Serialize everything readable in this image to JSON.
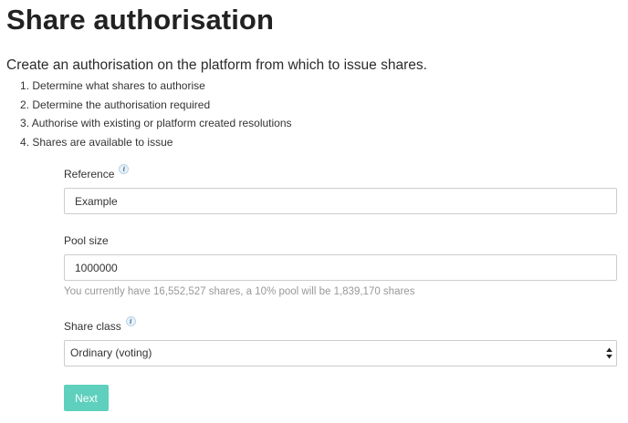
{
  "page": {
    "title": "Share authorisation",
    "intro": "Create an authorisation on the platform from which to issue shares."
  },
  "steps": [
    "Determine what shares to authorise",
    "Determine the authorisation required",
    "Authorise with existing or platform created resolutions",
    "Shares are available to issue"
  ],
  "form": {
    "reference": {
      "label": "Reference",
      "value": "Example"
    },
    "pool_size": {
      "label": "Pool size",
      "value": "1000000",
      "help": "You currently have 16,552,527 shares, a 10% pool will be 1,839,170 shares"
    },
    "share_class": {
      "label": "Share class",
      "selected": "Ordinary (voting)"
    },
    "info_icon_glyph": "i",
    "next_label": "Next"
  },
  "colors": {
    "primary_button": "#5ed0bd",
    "help_text": "#999999",
    "input_border": "#cccccc"
  }
}
